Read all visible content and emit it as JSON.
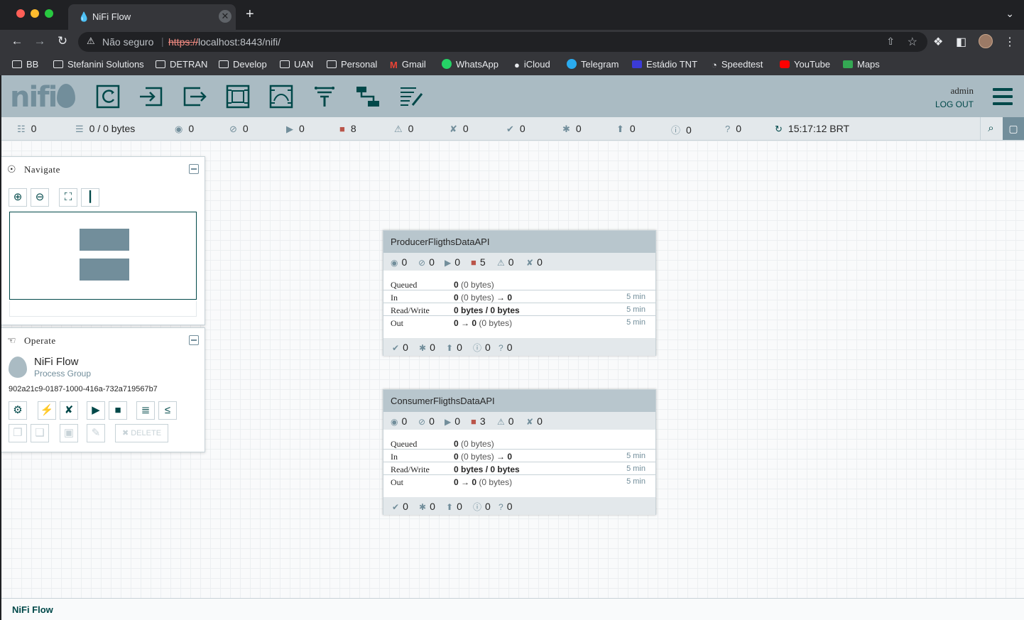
{
  "browser": {
    "tab_title": "NiFi Flow",
    "omnibox": {
      "security_label": "Não seguro",
      "url_scheme": "https://",
      "url_rest": "localhost:8443/nifi/"
    },
    "bookmarks": [
      {
        "label": "BB",
        "icon": "folder-icon"
      },
      {
        "label": "Stefanini Solutions",
        "icon": "folder-icon"
      },
      {
        "label": "DETRAN",
        "icon": "folder-icon"
      },
      {
        "label": "Develop",
        "icon": "folder-icon"
      },
      {
        "label": "UAN",
        "icon": "folder-icon"
      },
      {
        "label": "Personal",
        "icon": "folder-icon"
      },
      {
        "label": "Gmail",
        "icon": "gmail-icon"
      },
      {
        "label": "WhatsApp",
        "icon": "whatsapp-icon"
      },
      {
        "label": "iCloud",
        "icon": "apple-icon"
      },
      {
        "label": "Telegram",
        "icon": "telegram-icon"
      },
      {
        "label": "Estádio TNT",
        "icon": "ticket-icon"
      },
      {
        "label": "Speedtest",
        "icon": "speedtest-icon"
      },
      {
        "label": "YouTube",
        "icon": "youtube-icon"
      },
      {
        "label": "Maps",
        "icon": "maps-icon"
      }
    ]
  },
  "header": {
    "user": "admin",
    "logout": "LOG OUT"
  },
  "status": {
    "transmitting": "0",
    "queued": "0 / 0 bytes",
    "running_remote": "0",
    "stopped_remote": "0",
    "running": "0",
    "stopped": "8",
    "invalid": "0",
    "disabled": "0",
    "up_to_date": "0",
    "locally_modified": "0",
    "stale": "0",
    "modified_stale": "0",
    "sync_failure": "0",
    "refreshed": "15:17:12 BRT"
  },
  "navigate": {
    "title": "Navigate"
  },
  "operate": {
    "title": "Operate",
    "name": "NiFi Flow",
    "type": "Process Group",
    "id": "902a21c9-0187-1000-416a-732a719567b7",
    "delete_label": "DELETE"
  },
  "process_groups": [
    {
      "name": "ProducerFligthsDataAPI",
      "counts": {
        "transmitting": "0",
        "not_transmitting": "0",
        "running": "0",
        "stopped": "5",
        "invalid": "0",
        "disabled": "0"
      },
      "stats": {
        "queued_label": "Queued",
        "queued_count": "0",
        "queued_size": "(0 bytes)",
        "in_label": "In",
        "in_count": "0",
        "in_size": "(0 bytes)",
        "in_ports": "0",
        "in_time": "5 min",
        "rw_label": "Read/Write",
        "rw_value": "0 bytes / 0 bytes",
        "rw_time": "5 min",
        "out_label": "Out",
        "out_ports": "0",
        "out_count": "0",
        "out_size": "(0 bytes)",
        "out_time": "5 min"
      },
      "versions": {
        "up_to_date": "0",
        "locally_modified": "0",
        "stale": "0",
        "modified_stale": "0",
        "sync_failure": "0"
      }
    },
    {
      "name": "ConsumerFligthsDataAPI",
      "counts": {
        "transmitting": "0",
        "not_transmitting": "0",
        "running": "0",
        "stopped": "3",
        "invalid": "0",
        "disabled": "0"
      },
      "stats": {
        "queued_label": "Queued",
        "queued_count": "0",
        "queued_size": "(0 bytes)",
        "in_label": "In",
        "in_count": "0",
        "in_size": "(0 bytes)",
        "in_ports": "0",
        "in_time": "5 min",
        "rw_label": "Read/Write",
        "rw_value": "0 bytes / 0 bytes",
        "rw_time": "5 min",
        "out_label": "Out",
        "out_ports": "0",
        "out_count": "0",
        "out_size": "(0 bytes)",
        "out_time": "5 min"
      },
      "versions": {
        "up_to_date": "0",
        "locally_modified": "0",
        "stale": "0",
        "modified_stale": "0",
        "sync_failure": "0"
      }
    }
  ],
  "footer": {
    "breadcrumb": "NiFi Flow"
  },
  "colors": {
    "header_bg": "#aabbc3",
    "accent": "#004849",
    "stopped_red": "#ba554a"
  }
}
